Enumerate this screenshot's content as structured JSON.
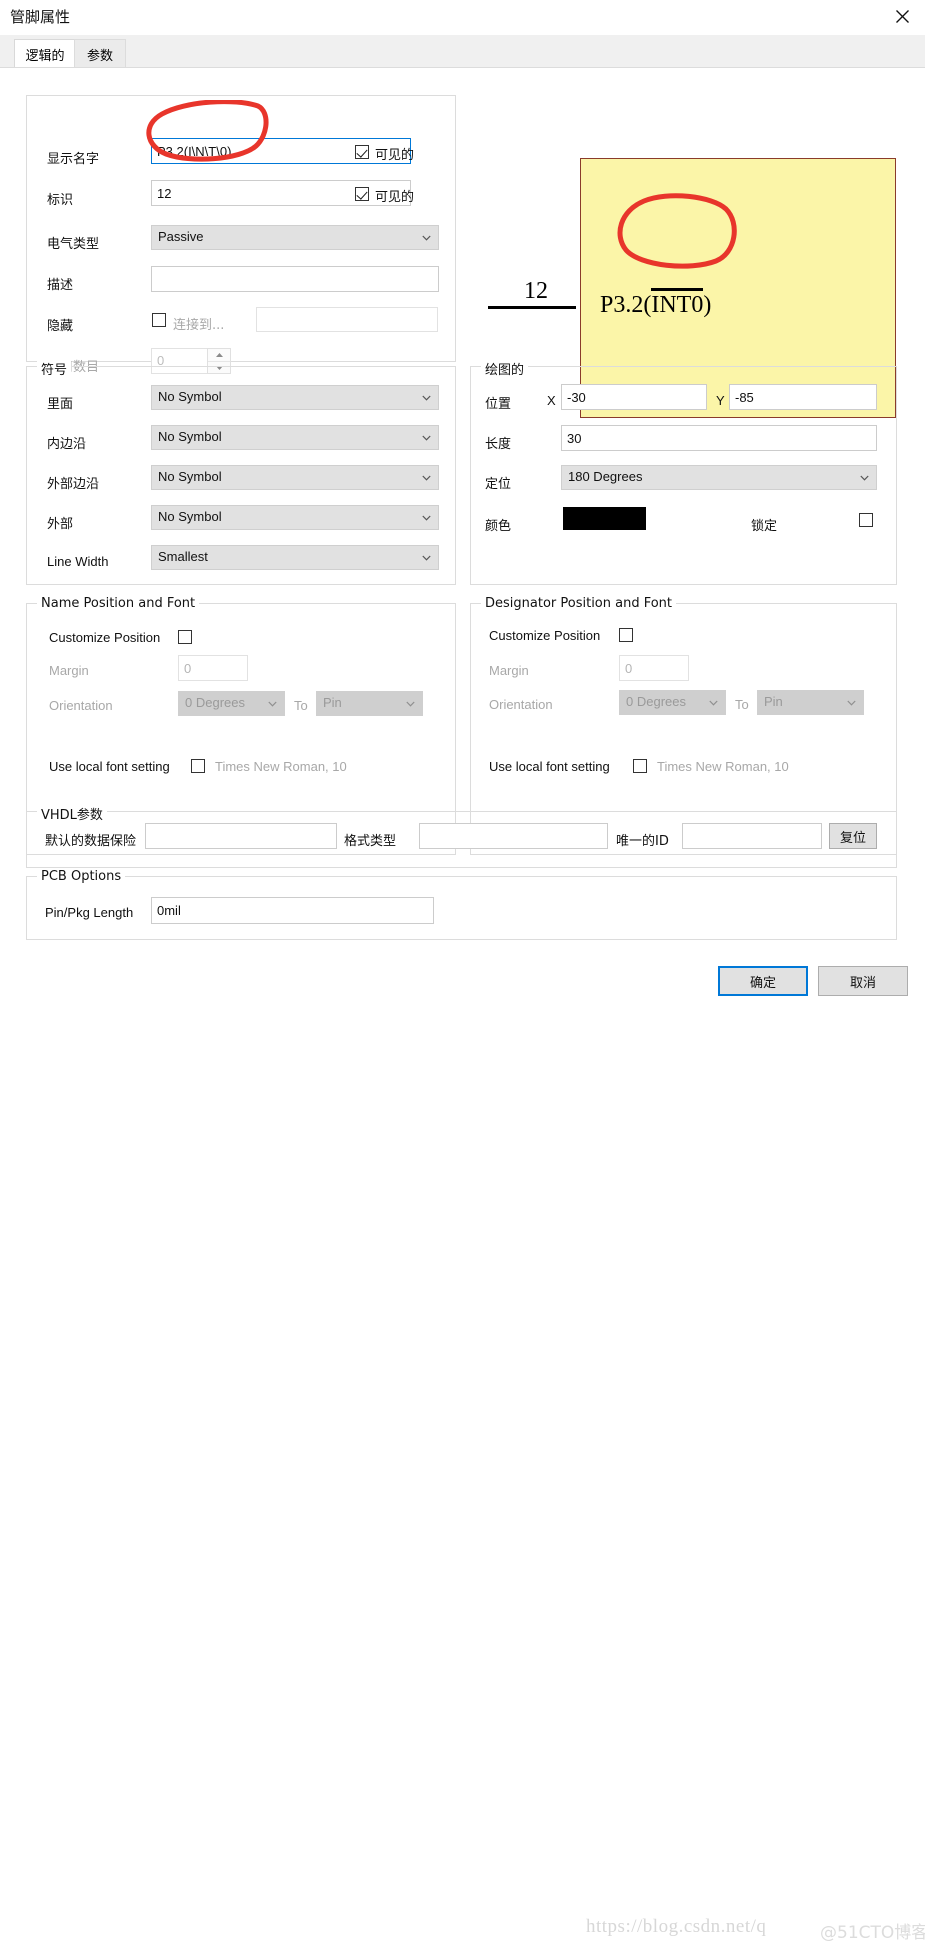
{
  "window": {
    "title": "管脚属性",
    "close_icon": "close-icon"
  },
  "tabs": [
    {
      "id": "logical",
      "label": "逻辑的",
      "active": true
    },
    {
      "id": "params",
      "label": "参数",
      "active": false
    }
  ],
  "logical": {
    "display_name": {
      "label": "显示名字",
      "value": "P3.2(I\\N\\T\\0)",
      "visible_label": "可见的",
      "visible_checked": true
    },
    "designator": {
      "label": "标识",
      "value": "12",
      "visible_label": "可见的",
      "visible_checked": true
    },
    "electrical_type": {
      "label": "电气类型",
      "value": "Passive"
    },
    "description": {
      "label": "描述",
      "value": ""
    },
    "hide": {
      "label": "隐藏",
      "checked": false,
      "connect_label": "连接到...",
      "connect_value": ""
    },
    "port_number": {
      "label": "端口数目",
      "value": "0",
      "disabled": true
    }
  },
  "symbol": {
    "title": "符号",
    "rows": [
      {
        "label": "里面",
        "value": "No Symbol"
      },
      {
        "label": "内边沿",
        "value": "No Symbol"
      },
      {
        "label": "外部边沿",
        "value": "No Symbol"
      },
      {
        "label": "外部",
        "value": "No Symbol"
      }
    ],
    "line_width": {
      "label": "Line Width",
      "value": "Smallest"
    }
  },
  "graphical": {
    "title": "绘图的",
    "position": {
      "label": "位置",
      "x_label": "X",
      "x_value": "-30",
      "y_label": "Y",
      "y_value": "-85"
    },
    "length": {
      "label": "长度",
      "value": "30"
    },
    "orientation": {
      "label": "定位",
      "value": "180 Degrees"
    },
    "color": {
      "label": "颜色",
      "value": "#000000"
    },
    "locked": {
      "label": "锁定",
      "checked": false
    }
  },
  "name_position": {
    "title": "Name Position and Font",
    "customize_position": {
      "label": "Customize Position",
      "checked": false
    },
    "margin": {
      "label": "Margin",
      "value": "0"
    },
    "orientation": {
      "label": "Orientation",
      "value": "0 Degrees",
      "to_label": "To",
      "to_value": "Pin"
    },
    "local_font": {
      "label": "Use local font setting",
      "checked": false,
      "font": "Times New Roman, 10"
    }
  },
  "designator_position": {
    "title": "Designator Position and Font",
    "customize_position": {
      "label": "Customize Position",
      "checked": false
    },
    "margin": {
      "label": "Margin",
      "value": "0"
    },
    "orientation": {
      "label": "Orientation",
      "value": "0 Degrees",
      "to_label": "To",
      "to_value": "Pin"
    },
    "local_font": {
      "label": "Use local font setting",
      "checked": false,
      "font": "Times New Roman, 10"
    }
  },
  "vhdl": {
    "title": "VHDL参数",
    "default_data_label": "默认的数据保险",
    "default_data_value": "",
    "format_type_label": "格式类型",
    "format_type_value": "",
    "unique_id_label": "唯一的ID",
    "unique_id_value": "",
    "reset_label": "复位"
  },
  "pcb": {
    "title": "PCB Options",
    "pin_pkg_label": "Pin/Pkg Length",
    "pin_pkg_value": "0mil"
  },
  "preview": {
    "designator": "12",
    "name_prefix": "P3.2(",
    "name_overline": "INT0",
    "name_suffix": ")",
    "background": "#fbf5a8",
    "border": "#8a3b2b"
  },
  "footer": {
    "ok_label": "确定",
    "cancel_label": "取消"
  },
  "watermark": {
    "url": "https://blog.csdn.net/q",
    "tag": "@51CTO博客"
  }
}
